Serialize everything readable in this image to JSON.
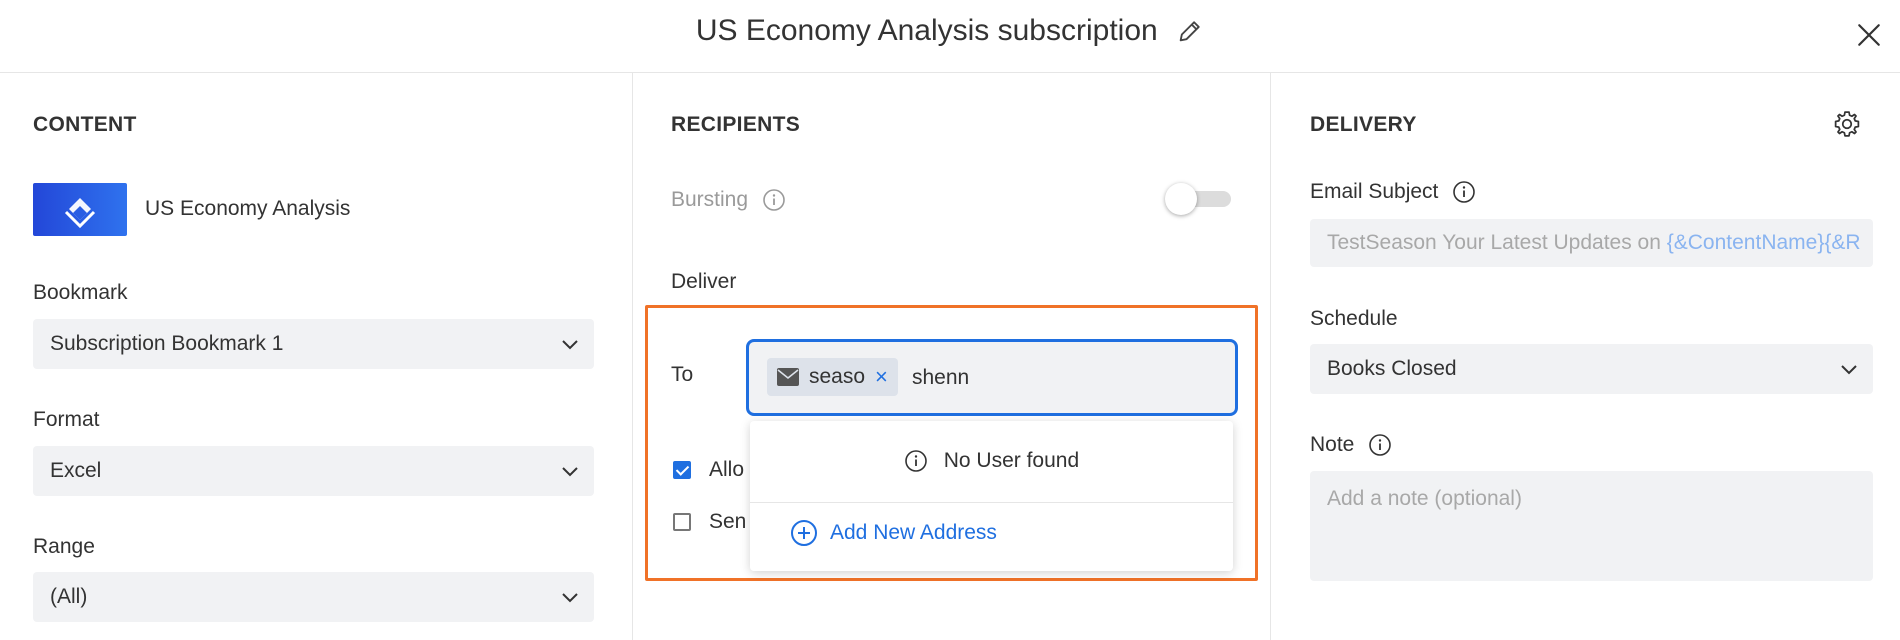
{
  "header": {
    "title": "US Economy Analysis subscription"
  },
  "content": {
    "section_title": "CONTENT",
    "item_name": "US Economy Analysis",
    "bookmark_label": "Bookmark",
    "bookmark_value": "Subscription Bookmark 1",
    "format_label": "Format",
    "format_value": "Excel",
    "range_label": "Range",
    "range_value": "(All)"
  },
  "recipients": {
    "section_title": "RECIPIENTS",
    "bursting_label": "Bursting",
    "deliver_label": "Deliver",
    "to_label": "To",
    "chip_text": "seaso",
    "chip_remove": "×",
    "typed_text": "shenn",
    "checkbox_1_text": "Allo",
    "checkbox_1_checked": true,
    "checkbox_2_text": "Sen",
    "checkbox_2_checked": false,
    "dropdown": {
      "no_user_text": "No User found",
      "add_new_text": "Add New Address"
    }
  },
  "delivery": {
    "section_title": "DELIVERY",
    "email_subject_label": "Email Subject",
    "email_subject_prefix": "TestSeason Your Latest Updates on ",
    "email_subject_token": "{&ContentName}{&R",
    "schedule_label": "Schedule",
    "schedule_value": "Books Closed",
    "note_label": "Note",
    "note_placeholder": "Add a note (optional)"
  },
  "colors": {
    "accent": "#1f6fe0",
    "highlight_border": "#f07228",
    "field_bg": "#f1f2f4"
  },
  "icons": [
    "edit-icon",
    "close-icon",
    "content-app-icon",
    "info-icon",
    "chevron-down-icon",
    "mail-icon",
    "plus-circle-icon",
    "gear-icon"
  ]
}
